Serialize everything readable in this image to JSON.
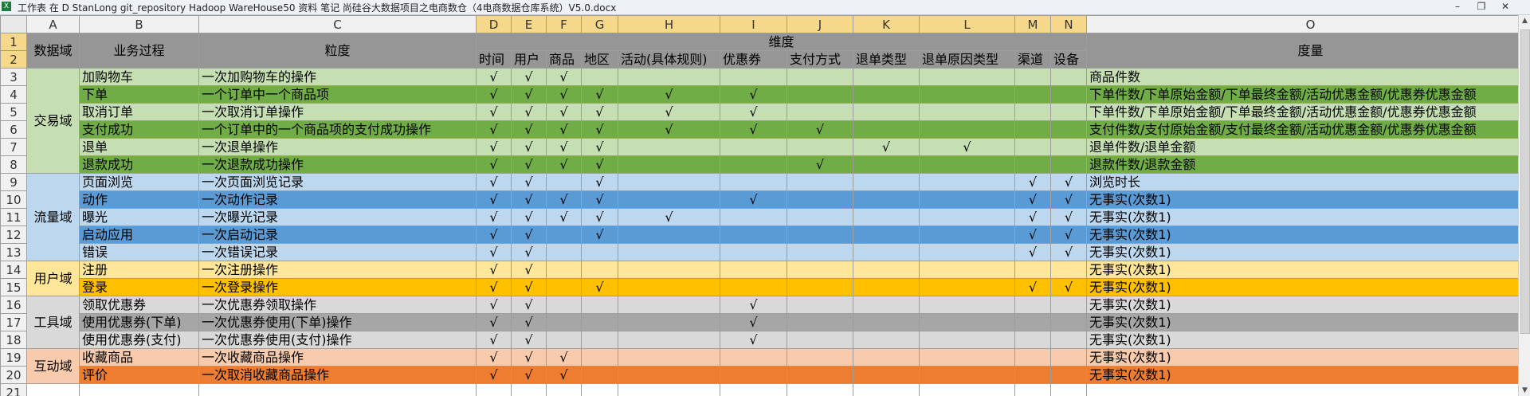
{
  "window": {
    "title": "工作表 在 D  StanLong git_repository Hadoop WareHouse50 资料 笔记 尚硅谷大数据项目之电商数仓（4电商数据仓库系统）V5.0.docx",
    "app_icon": "excel-icon",
    "min_label": "–",
    "restore_label": "❐",
    "close_label": "✕"
  },
  "colors": {
    "header_gray": "#969696",
    "selected_header": "#f5d88a",
    "trade_light": "#c5dfb3",
    "trade_dark": "#70ad47",
    "traffic_light": "#bdd7ee",
    "traffic_dark": "#5b9bd5",
    "user_light": "#ffe699",
    "user_dark": "#ffc000",
    "tool_light": "#d9d9d9",
    "tool_dark": "#a6a6a6",
    "interact_light": "#f8cbad",
    "interact_dark": "#ed7d31"
  },
  "columns": [
    "A",
    "B",
    "C",
    "D",
    "E",
    "F",
    "G",
    "H",
    "I",
    "J",
    "K",
    "L",
    "M",
    "N",
    "O"
  ],
  "rows": [
    "1",
    "2",
    "3",
    "4",
    "5",
    "6",
    "7",
    "8",
    "9",
    "10",
    "11",
    "12",
    "13",
    "14",
    "15",
    "16",
    "17",
    "18",
    "19",
    "20",
    "21"
  ],
  "header": {
    "domain": "数据域",
    "process": "业务过程",
    "grain": "粒度",
    "dimension": "维度",
    "measure": "度量",
    "dims": [
      "时间",
      "用户",
      "商品",
      "地区",
      "活动(具体规则)",
      "优惠券",
      "支付方式",
      "退单类型",
      "退单原因类型",
      "渠道",
      "设备"
    ]
  },
  "check_mark": "√",
  "domains": [
    {
      "name": "交易域",
      "start": 0,
      "span": 6
    },
    {
      "name": "流量域",
      "start": 6,
      "span": 5
    },
    {
      "name": "用户域",
      "start": 11,
      "span": 2
    },
    {
      "name": "工具域",
      "start": 13,
      "span": 3
    },
    {
      "name": "互动域",
      "start": 16,
      "span": 2
    }
  ],
  "records": [
    {
      "process": "加购物车",
      "grain": "一次加购物车的操作",
      "checks": [
        1,
        1,
        1,
        0,
        0,
        0,
        0,
        0,
        0,
        0,
        0
      ],
      "measure": "商品件数",
      "tone": "trade_light"
    },
    {
      "process": "下单",
      "grain": "一个订单中一个商品项",
      "checks": [
        1,
        1,
        1,
        1,
        1,
        1,
        0,
        0,
        0,
        0,
        0
      ],
      "measure": "下单件数/下单原始金额/下单最终金额/活动优惠金额/优惠券优惠金额",
      "tone": "trade_dark"
    },
    {
      "process": "取消订单",
      "grain": "一次取消订单操作",
      "checks": [
        1,
        1,
        1,
        1,
        1,
        1,
        0,
        0,
        0,
        0,
        0
      ],
      "measure": "下单件数/下单原始金额/下单最终金额/活动优惠金额/优惠券优惠金额",
      "tone": "trade_light"
    },
    {
      "process": "支付成功",
      "grain": "一个订单中的一个商品项的支付成功操作",
      "checks": [
        1,
        1,
        1,
        1,
        1,
        1,
        1,
        0,
        0,
        0,
        0
      ],
      "measure": "支付件数/支付原始金额/支付最终金额/活动优惠金额/优惠券优惠金额",
      "tone": "trade_dark"
    },
    {
      "process": "退单",
      "grain": "一次退单操作",
      "checks": [
        1,
        1,
        1,
        1,
        0,
        0,
        0,
        1,
        1,
        0,
        0
      ],
      "measure": "退单件数/退单金额",
      "tone": "trade_light"
    },
    {
      "process": "退款成功",
      "grain": "一次退款成功操作",
      "checks": [
        1,
        1,
        1,
        1,
        0,
        0,
        1,
        0,
        0,
        0,
        0
      ],
      "measure": "退款件数/退款金额",
      "tone": "trade_dark"
    },
    {
      "process": "页面浏览",
      "grain": "一次页面浏览记录",
      "checks": [
        1,
        1,
        0,
        1,
        0,
        0,
        0,
        0,
        0,
        1,
        1
      ],
      "measure": "浏览时长",
      "tone": "traffic_light"
    },
    {
      "process": "动作",
      "grain": "一次动作记录",
      "checks": [
        1,
        1,
        1,
        1,
        0,
        1,
        0,
        0,
        0,
        1,
        1
      ],
      "measure": "无事实(次数1)",
      "tone": "traffic_dark"
    },
    {
      "process": "曝光",
      "grain": "一次曝光记录",
      "checks": [
        1,
        1,
        1,
        1,
        1,
        0,
        0,
        0,
        0,
        1,
        1
      ],
      "measure": "无事实(次数1)",
      "tone": "traffic_light"
    },
    {
      "process": "启动应用",
      "grain": "一次启动记录",
      "checks": [
        1,
        1,
        0,
        1,
        0,
        0,
        0,
        0,
        0,
        1,
        1
      ],
      "measure": "无事实(次数1)",
      "tone": "traffic_dark"
    },
    {
      "process": "错误",
      "grain": "一次错误记录",
      "checks": [
        1,
        1,
        0,
        0,
        0,
        0,
        0,
        0,
        0,
        1,
        1
      ],
      "measure": "无事实(次数1)",
      "tone": "traffic_light"
    },
    {
      "process": "注册",
      "grain": "一次注册操作",
      "checks": [
        1,
        1,
        0,
        0,
        0,
        0,
        0,
        0,
        0,
        0,
        0
      ],
      "measure": "无事实(次数1)",
      "tone": "user_light"
    },
    {
      "process": "登录",
      "grain": "一次登录操作",
      "checks": [
        1,
        1,
        0,
        1,
        0,
        0,
        0,
        0,
        0,
        1,
        1
      ],
      "measure": "无事实(次数1)",
      "tone": "user_dark"
    },
    {
      "process": "领取优惠券",
      "grain": "一次优惠券领取操作",
      "checks": [
        1,
        1,
        0,
        0,
        0,
        1,
        0,
        0,
        0,
        0,
        0
      ],
      "measure": "无事实(次数1)",
      "tone": "tool_light"
    },
    {
      "process": "使用优惠券(下单)",
      "grain": "一次优惠券使用(下单)操作",
      "checks": [
        1,
        1,
        0,
        0,
        0,
        1,
        0,
        0,
        0,
        0,
        0
      ],
      "measure": "无事实(次数1)",
      "tone": "tool_dark"
    },
    {
      "process": "使用优惠券(支付)",
      "grain": "一次优惠券使用(支付)操作",
      "checks": [
        1,
        1,
        0,
        0,
        0,
        1,
        0,
        0,
        0,
        0,
        0
      ],
      "measure": "无事实(次数1)",
      "tone": "tool_light"
    },
    {
      "process": "收藏商品",
      "grain": "一次收藏商品操作",
      "checks": [
        1,
        1,
        1,
        0,
        0,
        0,
        0,
        0,
        0,
        0,
        0
      ],
      "measure": "无事实(次数1)",
      "tone": "interact_light"
    },
    {
      "process": "评价",
      "grain": "一次取消收藏商品操作",
      "checks": [
        1,
        1,
        1,
        0,
        0,
        0,
        0,
        0,
        0,
        0,
        0
      ],
      "measure": "无事实(次数1)",
      "tone": "interact_dark"
    }
  ]
}
